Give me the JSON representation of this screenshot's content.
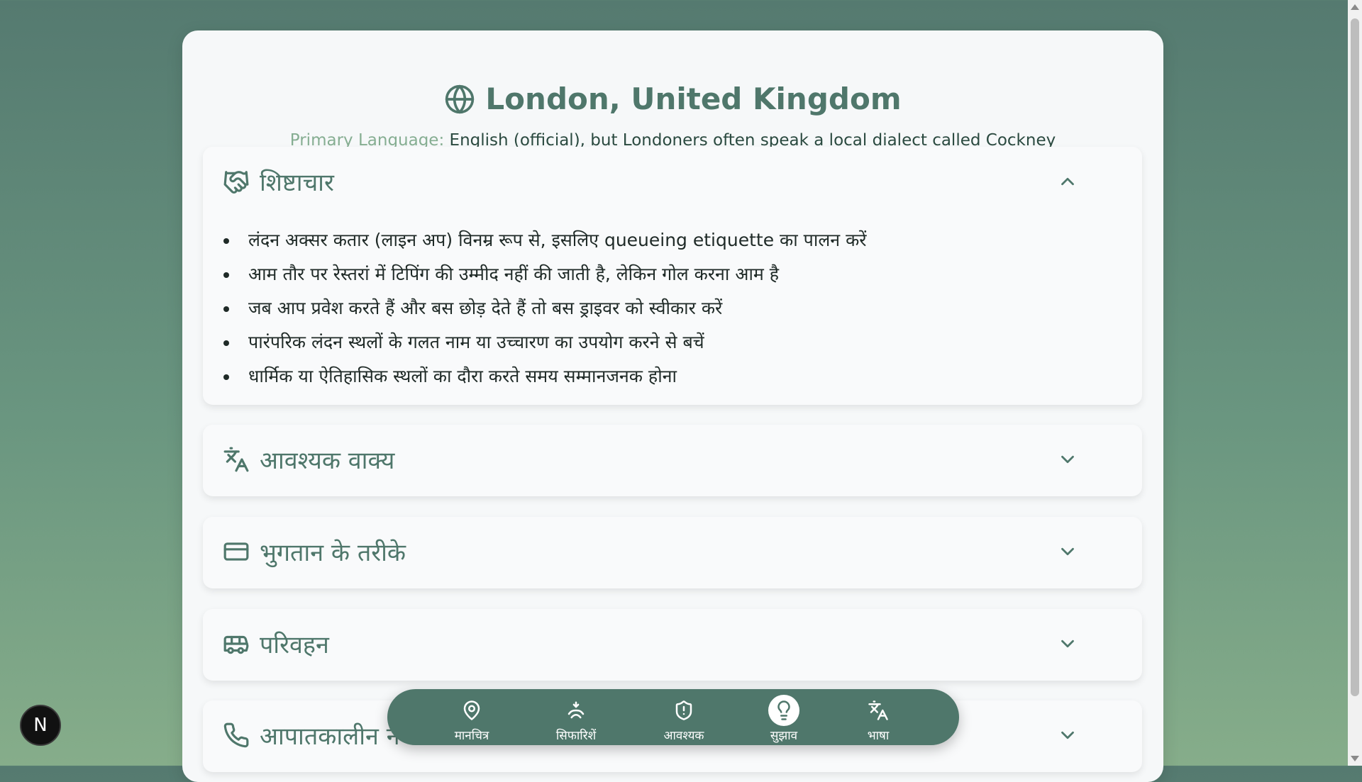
{
  "header": {
    "title": "London, United Kingdom",
    "language_label": "Primary Language:",
    "language_value": "English (official), but Londoners often speak a local dialect called Cockney"
  },
  "sections": [
    {
      "title": "शिष्टाचार",
      "icon": "handshake-icon",
      "expanded": true,
      "items": [
        "लंदन अक्सर कतार (लाइन अप) विनम्र रूप से, इसलिए queueing etiquette का पालन करें",
        "आम तौर पर रेस्तरां में टिपिंग की उम्मीद नहीं की जाती है, लेकिन गोल करना आम है",
        "जब आप प्रवेश करते हैं और बस छोड़ देते हैं तो बस ड्राइवर को स्वीकार करें",
        "पारंपरिक लंदन स्थलों के गलत नाम या उच्चारण का उपयोग करने से बचें",
        "धार्मिक या ऐतिहासिक स्थलों का दौरा करते समय सम्मानजनक होना"
      ]
    },
    {
      "title": "आवश्यक वाक्य",
      "icon": "translate-icon",
      "expanded": false
    },
    {
      "title": "भुगतान के तरीके",
      "icon": "credit-card-icon",
      "expanded": false
    },
    {
      "title": "परिवहन",
      "icon": "bus-icon",
      "expanded": false
    },
    {
      "title": "आपातकालीन न",
      "icon": "phone-icon",
      "expanded": false
    }
  ],
  "nav": [
    {
      "label": "मानचित्र",
      "icon": "map-pin-icon",
      "active": false
    },
    {
      "label": "सिफारिशें",
      "icon": "sparkle-hand-icon",
      "active": false
    },
    {
      "label": "आवश्यक",
      "icon": "shield-alert-icon",
      "active": false
    },
    {
      "label": "सुझाव",
      "icon": "lightbulb-icon",
      "active": true
    },
    {
      "label": "भाषा",
      "icon": "translate-icon",
      "active": false
    }
  ],
  "badge": {
    "letter": "N"
  },
  "colors": {
    "accent": "#4f776b",
    "background_top": "#557a70",
    "background_bottom": "#86ad8a",
    "card": "#f6f8f9"
  }
}
